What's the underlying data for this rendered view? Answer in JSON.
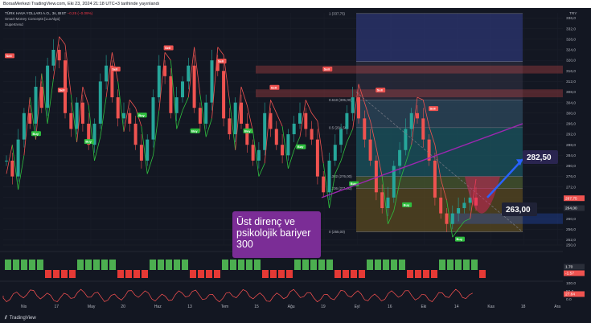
{
  "header": {
    "text": "BorsaMerkezi TradingView.com, Eki 23, 2024 21:18 UTC+3 tarihinde yayınlandı"
  },
  "legend": {
    "ticker": "TÜRK HAVA YOLLARI A.O., 3s, BIST",
    "change": "−0.25 (−0.09%)",
    "line2": "Smart Money Concepts [LuxAlgo]",
    "line3": "Supertrend"
  },
  "currency": "TRY",
  "footer": {
    "logo": "⫽",
    "brand": "TradingView"
  },
  "colors": {
    "up": "#26a69a",
    "down": "#ef5350",
    "supertrend_up": "#2fbf3f",
    "supertrend_down": "#ef5350",
    "annotation_bg": "#7b2d96",
    "tag_bg": "#2a2550",
    "arrow": "#2962ff",
    "trendline": "#9c27b0"
  },
  "annotations": {
    "text_lines": [
      "Üst direnç ve",
      "psikolojik bariyer",
      "300"
    ],
    "target_label": "282,50",
    "support_label": "263,00"
  },
  "chart_data": [
    {
      "type": "candlestick",
      "title": "",
      "y_axis_ticks": [
        250,
        252,
        256,
        260,
        264,
        268,
        272,
        276,
        280,
        284,
        288,
        292,
        296,
        300,
        304,
        308,
        312,
        316,
        320,
        324,
        328,
        332,
        336
      ],
      "x_axis_ticks": [
        "Nis",
        "17",
        "May",
        "20",
        "Haz",
        "13",
        "Tem",
        "15",
        "Ağu",
        "19",
        "Eyl",
        "16",
        "Eki",
        "14",
        "Kas",
        "18",
        "Ara"
      ],
      "price_range": [
        250,
        338
      ],
      "last_price": 267.75,
      "price_labels": [
        "267,75",
        "264,00"
      ],
      "fibonacci": [
        {
          "level": "1",
          "price": 337.75,
          "label": "1 (337,75)"
        },
        {
          "level": "0.786",
          "price": 319.5,
          "label": ""
        },
        {
          "level": "0.618",
          "price": 305.0,
          "label": "0.618 (305,00)"
        },
        {
          "level": "0.5",
          "price": 294.5,
          "label": "0.5 (294,50)"
        },
        {
          "level": "0.382",
          "price": 276.0,
          "label": "0.382 (276,00)"
        },
        {
          "level": "0.236",
          "price": 271.5,
          "label": "0.236 (271,50)"
        },
        {
          "level": "0",
          "price": 255.0,
          "label": "0 (255,00)"
        }
      ],
      "supply_zones": [
        [
          315,
          318
        ],
        [
          306,
          309
        ]
      ],
      "demand_zones": [
        [
          258,
          262
        ]
      ],
      "signals": [
        {
          "type": "Sell",
          "price": 319
        },
        {
          "type": "Buy",
          "price": 295
        },
        {
          "type": "Sell",
          "price": 306
        },
        {
          "type": "Buy",
          "price": 292
        },
        {
          "type": "Sell",
          "price": 314
        },
        {
          "type": "Buy",
          "price": 302
        },
        {
          "type": "Sell",
          "price": 322
        },
        {
          "type": "Buy",
          "price": 296
        },
        {
          "type": "Sell",
          "price": 317
        },
        {
          "type": "Buy",
          "price": 296
        },
        {
          "type": "Sell",
          "price": 307
        },
        {
          "type": "Buy",
          "price": 290
        },
        {
          "type": "Sell",
          "price": 314
        },
        {
          "type": "Buy",
          "price": 276
        },
        {
          "type": "Sell",
          "price": 306
        },
        {
          "type": "Buy",
          "price": 268
        },
        {
          "type": "Sell",
          "price": 299
        },
        {
          "type": "Buy",
          "price": 255
        }
      ],
      "series": [
        {
          "name": "Close",
          "values": [
            282,
            276,
            290,
            300,
            296,
            310,
            302,
            318,
            324,
            320,
            300,
            294,
            304,
            296,
            288,
            296,
            312,
            318,
            306,
            298,
            300,
            296,
            288,
            282,
            290,
            306,
            318,
            314,
            300,
            306,
            312,
            318,
            302,
            296,
            304,
            320,
            316,
            298,
            292,
            304,
            296,
            288,
            282,
            286,
            300,
            294,
            288,
            284,
            292,
            296,
            300,
            294,
            290,
            276,
            270,
            282,
            288,
            294,
            300,
            306,
            298,
            290,
            282,
            270,
            264,
            268,
            280,
            286,
            294,
            300,
            298,
            290,
            282,
            268,
            262,
            258,
            262,
            264,
            266,
            268,
            265
          ]
        }
      ]
    },
    {
      "type": "area",
      "title": "",
      "y_axis_ticks": [],
      "price_labels": [
        "1.70",
        "-1.57"
      ]
    },
    {
      "type": "line",
      "title": "",
      "y_axis_ticks": [
        "100.0",
        "50.0",
        "0.0"
      ],
      "price_labels": [
        "27.84"
      ]
    }
  ]
}
